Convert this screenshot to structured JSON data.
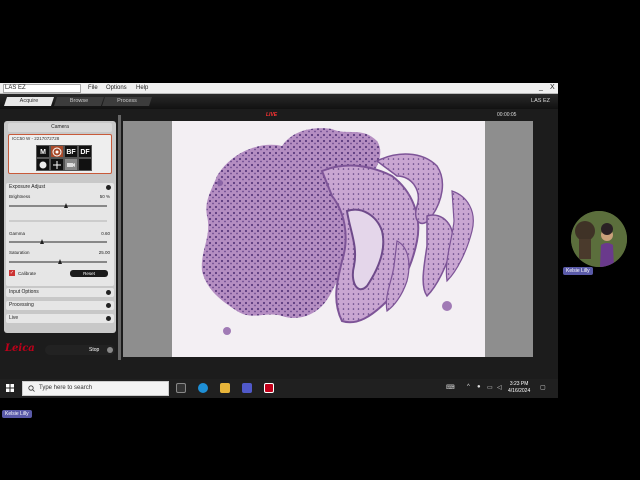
{
  "app": {
    "title": "LAS EZ",
    "menu": [
      "File",
      "Options",
      "Help"
    ],
    "window_buttons": [
      "_",
      "X"
    ],
    "tabs": [
      "Acquire",
      "Browse",
      "Process"
    ],
    "active_tab": "Acquire",
    "header_label": "LAS EZ"
  },
  "left_panel": {
    "title": "Camera",
    "camera_id": "ICC50 W - 2217072728",
    "camera_buttons": [
      "M",
      "",
      "BF",
      "DF"
    ],
    "exposure": {
      "title": "Exposure Adjust",
      "brightness_label": "Brightness",
      "brightness_value": "50 %",
      "gamma_label": "Gamma",
      "gamma_value": "0.60",
      "saturation_label": "Saturation",
      "saturation_value": "25.00",
      "calibrate_label": "Calibrate",
      "reset_label": "Reset"
    },
    "sections": [
      "Input Options",
      "Processing",
      "Live"
    ],
    "stop_label": "Stop"
  },
  "viewer": {
    "live_label": "LIVE",
    "timer": "00:00:05"
  },
  "taskbar": {
    "search_placeholder": "Type here to search",
    "time": "3:23 PM",
    "date": "4/16/2024"
  },
  "participants": {
    "video_name": "Kelsie Lilly",
    "self_name": "Kelsie Lilly"
  },
  "brand": {
    "logo_text": "Leica",
    "accent": "#c0001a"
  }
}
